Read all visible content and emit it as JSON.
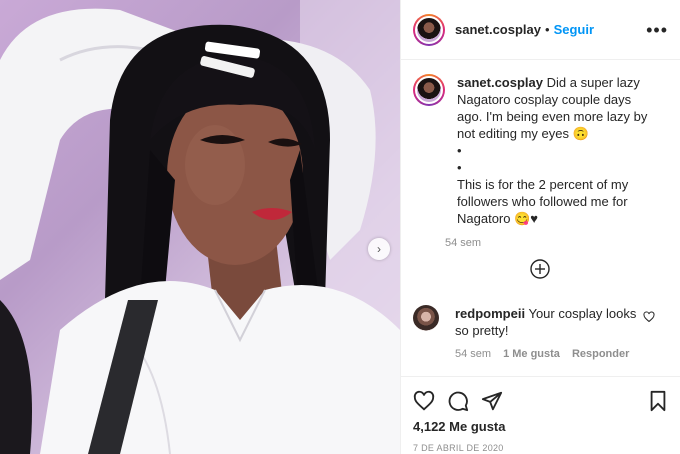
{
  "header": {
    "username": "sanet.cosplay",
    "separator": "•",
    "follow_label": "Seguir",
    "more_icon": "more-horizontal-icon"
  },
  "caption": {
    "username": "sanet.cosplay",
    "lines": [
      "Did a super lazy Nagatoro cosplay couple days ago. I'm being even more lazy by not editing my eyes 🙃",
      "•",
      "•",
      "This is for the 2 percent of my followers who followed me for Nagatoro 😋♥"
    ],
    "time": "54 sem"
  },
  "add_comment_icon": "plus-circle-icon",
  "comment": {
    "username": "redpompeii",
    "text": "Your cosplay looks so pretty!",
    "time": "54 sem",
    "likes": "1 Me gusta",
    "reply_label": "Responder"
  },
  "actions": {
    "icons": [
      "heart-icon",
      "comment-icon",
      "share-icon",
      "bookmark-icon"
    ]
  },
  "likes_text": "4,122 Me gusta",
  "date_text": "7 DE ABRIL DE 2020",
  "colors": {
    "accent": "#0095f6",
    "text": "#262626",
    "muted": "#8e8e8e",
    "divider": "#efefef"
  }
}
